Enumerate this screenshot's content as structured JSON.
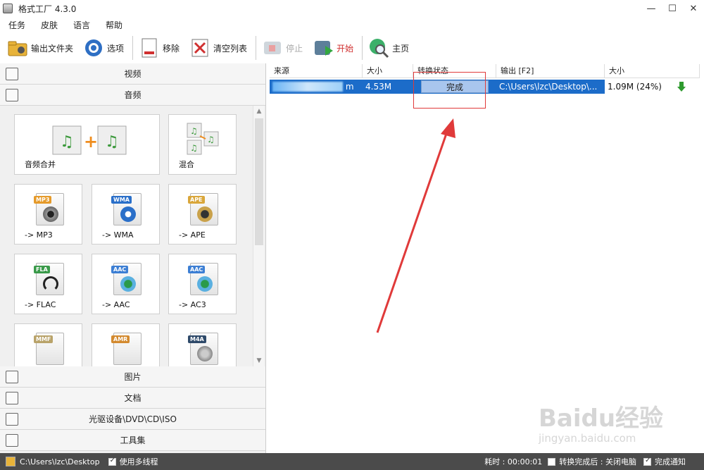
{
  "window": {
    "title": "格式工厂 4.3.0",
    "minimize": "—",
    "maximize": "☐",
    "close": "✕"
  },
  "menu": [
    "任务",
    "皮肤",
    "语言",
    "帮助"
  ],
  "toolbar": {
    "output_folder": "输出文件夹",
    "options": "选项",
    "remove": "移除",
    "clear_list": "清空列表",
    "stop": "停止",
    "start": "开始",
    "home": "主页"
  },
  "categories": {
    "video": "视频",
    "audio": "音频",
    "picture": "图片",
    "document": "文档",
    "rom": "光驱设备\\DVD\\CD\\ISO",
    "tools": "工具集"
  },
  "tiles": [
    {
      "label": "音频合并",
      "badge": "",
      "color": "#4aa04a"
    },
    {
      "label": "混合",
      "badge": "",
      "color": "#4aa04a"
    },
    {
      "label": "-> MP3",
      "badge": "MP3",
      "color": "#e59a2a"
    },
    {
      "label": "-> WMA",
      "badge": "WMA",
      "color": "#2a6fc9"
    },
    {
      "label": "-> APE",
      "badge": "APE",
      "color": "#d9a63a"
    },
    {
      "label": "-> FLAC",
      "badge": "FLA",
      "color": "#3a9a4a"
    },
    {
      "label": "-> AAC",
      "badge": "AAC",
      "color": "#3d7fd4"
    },
    {
      "label": "-> AC3",
      "badge": "AAC",
      "color": "#3d7fd4"
    },
    {
      "label": "",
      "badge": "MMF",
      "color": "#b9a36a"
    },
    {
      "label": "",
      "badge": "AMR",
      "color": "#d38a2f"
    },
    {
      "label": "",
      "badge": "M4A",
      "color": "#2f4a6a"
    }
  ],
  "table": {
    "headers": [
      "来源",
      "大小",
      "转换状态",
      "输出 [F2]",
      "大小"
    ],
    "row": {
      "source_suffix": "m",
      "size": "4.53M",
      "status": "完成",
      "output": "C:\\Users\\lzc\\Desktop\\...",
      "out_size": "1.09M",
      "ratio": "(24%)"
    }
  },
  "statusbar": {
    "path": "C:\\Users\\lzc\\Desktop",
    "multithread": "使用多线程",
    "elapsed": "耗时 : 00:00:01",
    "after_convert": "转换完成后 : 关闭电脑",
    "notify": "完成通知"
  },
  "watermark": {
    "brand": "Baidu经验",
    "url": "jingyan.baidu.com"
  },
  "colors": {
    "selection": "#1c6cc9",
    "annotation": "#e03a3a",
    "statusbar": "#4b4b4b"
  }
}
